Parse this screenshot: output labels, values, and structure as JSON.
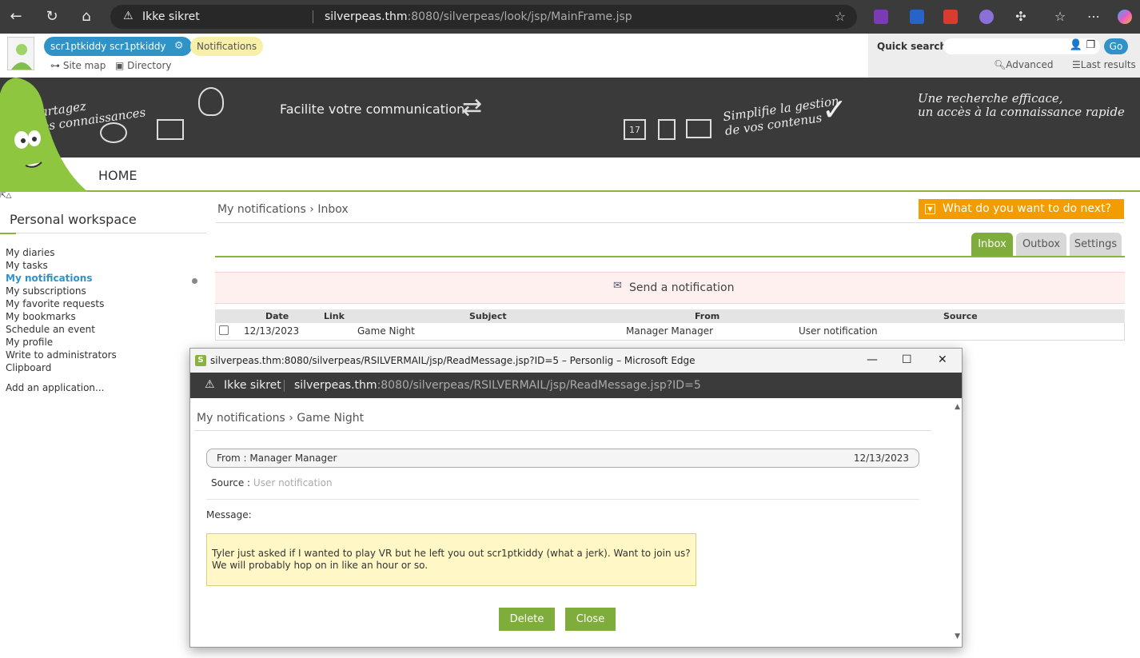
{
  "browser": {
    "security_label": "Ikke sikret",
    "url_host": "silverpeas.thm",
    "url_rest": ":8080/silverpeas/look/jsp/MainFrame.jsp"
  },
  "header": {
    "user_name": "scr1ptkiddy scr1ptkiddy",
    "notifications": "Notifications",
    "site_map": "Site map",
    "directory": "Directory",
    "quick_search_label": "Quick search",
    "go": "Go",
    "advanced": "Advanced",
    "last_results": "Last results"
  },
  "banner": {
    "text1_line1": "Partagez",
    "text1_line2": "vos connaissances",
    "text2": "Facilite votre communication",
    "text3_line1": "Simplifie la gestion",
    "text3_line2": "de vos contenus",
    "text4_line1": "Une recherche efficace,",
    "text4_line2": "un accès à la connaissance rapide",
    "calendar_day": "17"
  },
  "nav": {
    "home": "HOME"
  },
  "sidebar": {
    "title": "Personal workspace",
    "items": [
      "My diaries",
      "My tasks",
      "My notifications",
      "My subscriptions",
      "My favorite requests",
      "My bookmarks",
      "Schedule an event",
      "My profile",
      "Write to administrators",
      "Clipboard"
    ],
    "add_app": "Add an application..."
  },
  "main": {
    "crumb_parent": "My notifications",
    "crumb_current": "Inbox",
    "todo": "What do you want to do next?",
    "tabs": {
      "inbox": "Inbox",
      "outbox": "Outbox",
      "settings": "Settings"
    },
    "send": "Send a notification",
    "columns": {
      "date": "Date",
      "link": "Link",
      "subject": "Subject",
      "from": "From",
      "source": "Source"
    },
    "rows": [
      {
        "date": "12/13/2023",
        "subject": "Game Night",
        "from": "Manager Manager",
        "source": "User notification"
      }
    ]
  },
  "popup": {
    "window_title": "silverpeas.thm:8080/silverpeas/RSILVERMAIL/jsp/ReadMessage.jsp?ID=5 – Personlig – Microsoft Edge",
    "security_label": "Ikke sikret",
    "url_host": "silverpeas.thm",
    "url_rest": ":8080/silverpeas/RSILVERMAIL/jsp/ReadMessage.jsp?ID=5",
    "crumb_parent": "My notifications",
    "crumb_current": "Game Night",
    "from": "From : Manager Manager",
    "date": "12/13/2023",
    "source_label": "Source :",
    "source_value": "User notification",
    "message_label": "Message:",
    "message": "Tyler just asked if I wanted to play VR but he left you out scr1ptkiddy (what a jerk). Want to join us? We will probably hop on in like an hour or so.",
    "delete": "Delete",
    "close": "Close"
  }
}
